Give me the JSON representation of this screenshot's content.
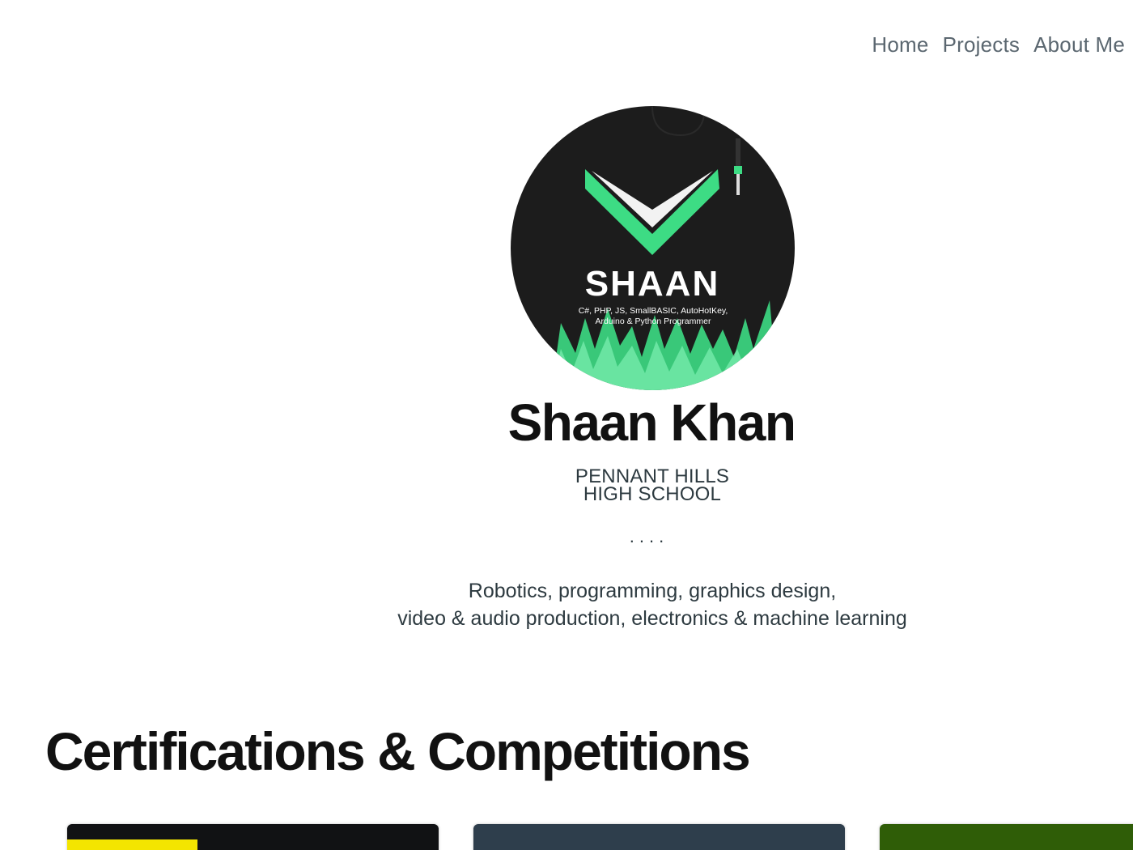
{
  "nav": {
    "items": [
      {
        "label": "Home"
      },
      {
        "label": "Projects"
      },
      {
        "label": "About Me"
      }
    ]
  },
  "profile": {
    "logo_word": "SHAAN",
    "logo_tagline_1": "C#, PHP, JS, SmallBASIC, AutoHotKey,",
    "logo_tagline_2": "Arduino & Python Programmer",
    "name": "Shaan Khan",
    "school_line_1": "PENNANT HILLS",
    "school_line_2": "HIGH SCHOOL",
    "divider": "....",
    "interests_line_1": "Robotics, programming, graphics design,",
    "interests_line_2": "video & audio production, electronics & machine learning"
  },
  "section": {
    "title": "Certifications & Competitions"
  },
  "colors": {
    "brand_green": "#3ddc84",
    "logo_bg": "#1c1c1c",
    "card_1": "#111214",
    "card_1_stripe": "#f3e500",
    "card_2": "#2e3e4c",
    "card_3": "#2f5d07"
  }
}
